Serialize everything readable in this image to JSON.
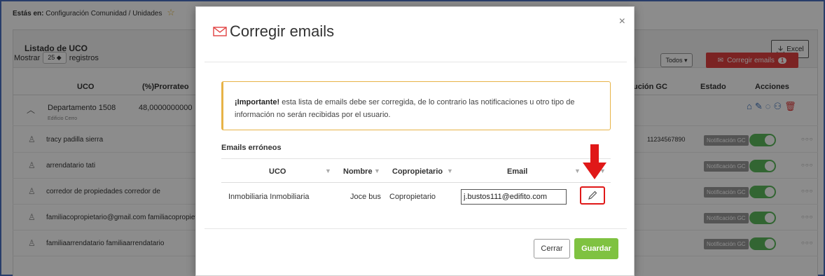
{
  "breadcrumb": {
    "prefix": "Estás en:",
    "path": "Configuración Comunidad  /  Unidades"
  },
  "panel": {
    "title": "Listado de UCO",
    "excel_label": "Excel"
  },
  "controls": {
    "mostrar": "Mostrar",
    "page_size": "25 ◆",
    "registros": "registros",
    "todos": "Todos ▾",
    "corregir_label": "Corregir emails",
    "corregir_count": "1"
  },
  "table": {
    "col_uco": "UCO",
    "col_prorrateo": "(%)Prorrateo",
    "col_ucion": "ución GC",
    "col_estado": "Estado",
    "col_acciones": "Acciones"
  },
  "department": {
    "name": "Departamento 1508",
    "building": "Edificio Cerro",
    "prorrateo": "48,0000000000"
  },
  "residents": [
    {
      "name": "tracy padilla sierra",
      "phone": "11234567890",
      "notif": "Notificación GC"
    },
    {
      "name": "arrendatario tati",
      "phone": "",
      "notif": "Notificación GC"
    },
    {
      "name": "corredor de propiedades corredor de",
      "phone": "",
      "notif": "Notificación GC"
    },
    {
      "name": "familiacopropietario@gmail.com familiacopropieta",
      "phone": "",
      "notif": "Notificación GC"
    },
    {
      "name": "familiaarrendatario familiaarrendatario",
      "phone": "",
      "notif": "Notificación GC"
    }
  ],
  "modal": {
    "title": "Corregir emails",
    "close": "×",
    "alert_strong": "¡Importante!",
    "alert_text": " esta lista de emails debe ser corregida, de lo contrario las notificaciones u otro tipo de información no serán recibidas por el usuario.",
    "section_title": "Emails erróneos",
    "headers": {
      "uco": "UCO",
      "nombre": "Nombre",
      "copropietario": "Copropietario",
      "email": "Email"
    },
    "row": {
      "uco": "Inmobiliaria Inmobiliaria",
      "nombre": "Joce bus",
      "tipo": "Copropietario",
      "email": "j.bustos111@edifito.com"
    },
    "cerrar": "Cerrar",
    "guardar": "Guardar"
  },
  "colors": {
    "accent_red": "#e01818",
    "guardar_green": "#7fc241",
    "alert_border": "#e7b347",
    "switch_green": "#5cb85c"
  }
}
